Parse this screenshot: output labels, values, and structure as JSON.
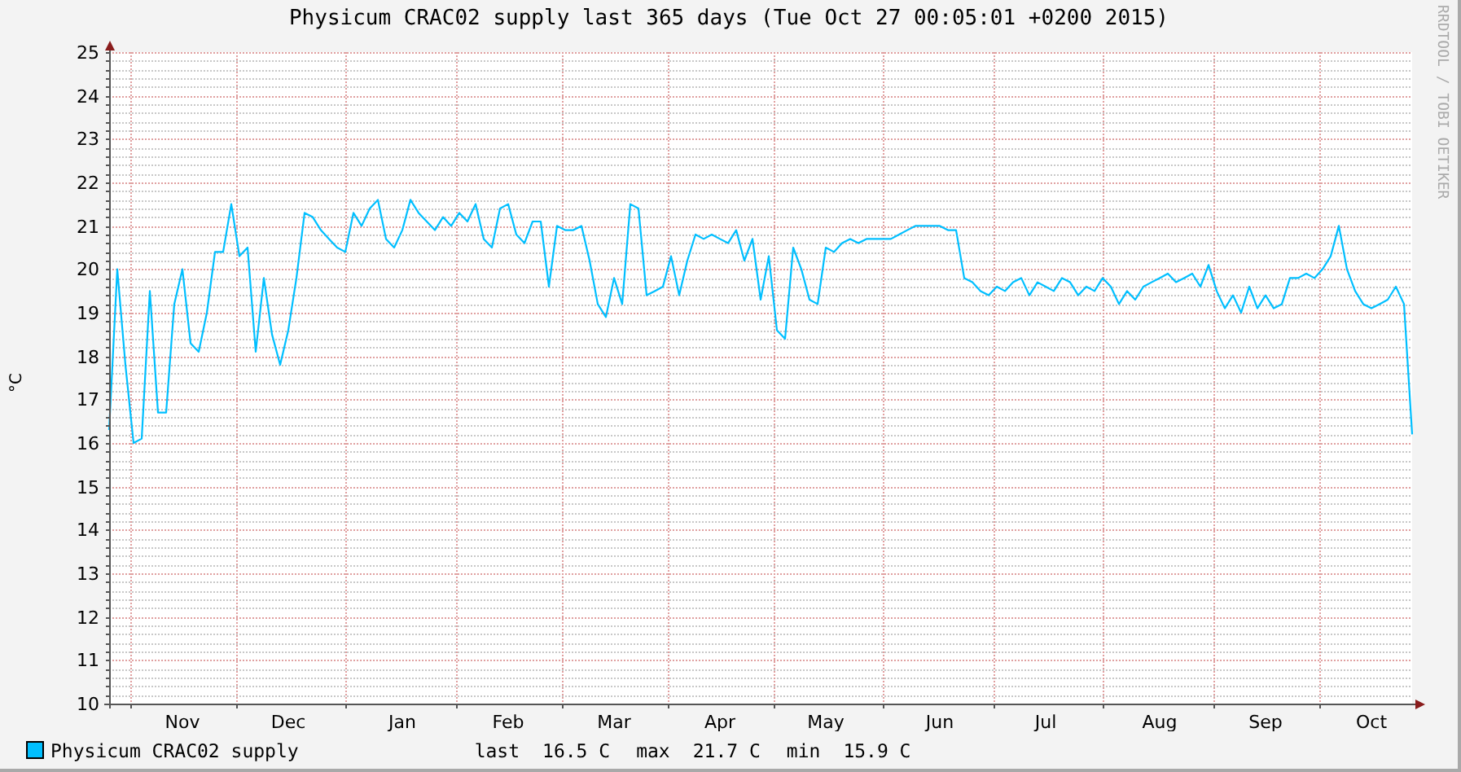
{
  "chart_data": {
    "type": "line",
    "title": "Physicum CRAC02 supply last 365 days (Tue Oct 27 00:05:01 +0200 2015)",
    "ylabel": "°C",
    "categories": [
      null,
      null,
      null,
      null,
      null,
      null,
      null,
      null,
      null,
      "Nov",
      null,
      null,
      null,
      null,
      null,
      null,
      null,
      null,
      null,
      null,
      null,
      null,
      "Dec",
      null,
      null,
      null,
      null,
      null,
      null,
      null,
      null,
      null,
      null,
      null,
      null,
      null,
      "Jan",
      null,
      null,
      null,
      null,
      null,
      null,
      null,
      null,
      null,
      null,
      null,
      null,
      "Feb",
      null,
      null,
      null,
      null,
      null,
      null,
      null,
      null,
      null,
      null,
      null,
      null,
      "Mar",
      null,
      null,
      null,
      null,
      null,
      null,
      null,
      null,
      null,
      null,
      null,
      null,
      "Apr",
      null,
      null,
      null,
      null,
      null,
      null,
      null,
      null,
      null,
      null,
      null,
      null,
      "May",
      null,
      null,
      null,
      null,
      null,
      null,
      null,
      null,
      null,
      null,
      null,
      null,
      null,
      "Jun",
      null,
      null,
      null,
      null,
      null,
      null,
      null,
      null,
      null,
      null,
      null,
      null,
      "Jul",
      null,
      null,
      null,
      null,
      null,
      null,
      null,
      null,
      null,
      null,
      null,
      null,
      null,
      "Aug",
      null,
      null,
      null,
      null,
      null,
      null,
      null,
      null,
      null,
      null,
      null,
      null,
      "Sep",
      null,
      null,
      null,
      null,
      null,
      null,
      null,
      null,
      null,
      null,
      null,
      null,
      "Oct",
      null,
      null,
      null,
      null,
      null
    ],
    "series": [
      {
        "name": "Physicum CRAC02 supply",
        "color": "#00bfff",
        "values": [
          16.3,
          20.0,
          17.8,
          16.0,
          16.1,
          19.5,
          16.7,
          16.7,
          19.2,
          20.0,
          18.3,
          18.1,
          19.0,
          20.4,
          20.4,
          21.5,
          20.3,
          20.5,
          18.1,
          19.8,
          18.5,
          17.8,
          18.6,
          19.8,
          21.3,
          21.2,
          20.9,
          20.7,
          20.5,
          20.4,
          21.3,
          21.0,
          21.4,
          21.6,
          20.7,
          20.5,
          20.9,
          21.6,
          21.3,
          21.1,
          20.9,
          21.2,
          21.0,
          21.3,
          21.1,
          21.5,
          20.7,
          20.5,
          21.4,
          21.5,
          20.8,
          20.6,
          21.1,
          21.1,
          19.6,
          21.0,
          20.9,
          20.9,
          21.0,
          20.2,
          19.2,
          18.9,
          19.8,
          19.2,
          21.5,
          21.4,
          19.4,
          19.5,
          19.6,
          20.3,
          19.4,
          20.2,
          20.8,
          20.7,
          20.8,
          20.7,
          20.6,
          20.9,
          20.2,
          20.7,
          19.3,
          20.3,
          18.6,
          18.4,
          20.5,
          20.0,
          19.3,
          19.2,
          20.5,
          20.4,
          20.6,
          20.7,
          20.6,
          20.7,
          20.7,
          20.7,
          20.7,
          20.8,
          20.9,
          21.0,
          21.0,
          21.0,
          21.0,
          20.9,
          20.9,
          19.8,
          19.7,
          19.5,
          19.4,
          19.6,
          19.5,
          19.7,
          19.8,
          19.4,
          19.7,
          19.6,
          19.5,
          19.8,
          19.7,
          19.4,
          19.6,
          19.5,
          19.8,
          19.6,
          19.2,
          19.5,
          19.3,
          19.6,
          19.7,
          19.8,
          19.9,
          19.7,
          19.8,
          19.9,
          19.6,
          20.1,
          19.5,
          19.1,
          19.4,
          19.0,
          19.6,
          19.1,
          19.4,
          19.1,
          19.2,
          19.8,
          19.8,
          19.9,
          19.8,
          20.0,
          20.3,
          21.0,
          20.0,
          19.5,
          19.2,
          19.1,
          19.2,
          19.3,
          19.6,
          19.2,
          16.2
        ]
      }
    ],
    "ylim": [
      10,
      25
    ],
    "grid": true,
    "yticks": [
      10,
      11,
      12,
      13,
      14,
      15,
      16,
      17,
      18,
      19,
      20,
      21,
      22,
      23,
      24,
      25
    ]
  },
  "legend_stats": [
    {
      "label": "last",
      "value": "16.5 C"
    },
    {
      "label": "max",
      "value": "21.7 C"
    },
    {
      "label": "min",
      "value": "15.9 C"
    }
  ],
  "credit": "RRDTOOL / TOBI OETIKER"
}
